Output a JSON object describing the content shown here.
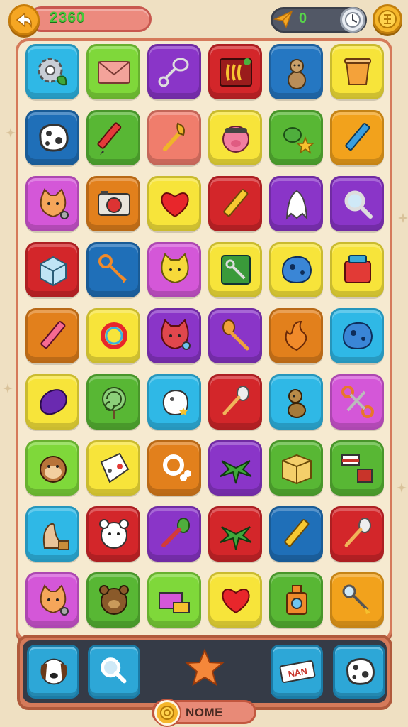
{
  "header": {
    "score": "2360",
    "plane_count": "0",
    "back_icon": "back-arrow-icon",
    "timer_icon": "clock-icon",
    "coin_icon": "coin-icon"
  },
  "board": {
    "columns": 6,
    "rows": 9,
    "tiles": [
      {
        "color": "#2fb8e6",
        "icon": "gear-leaf"
      },
      {
        "color": "#7fd83a",
        "icon": "envelope"
      },
      {
        "color": "#8a35c8",
        "icon": "racket"
      },
      {
        "color": "#d3262a",
        "icon": "book"
      },
      {
        "color": "#2577c2",
        "icon": "otter"
      },
      {
        "color": "#f7e43a",
        "icon": "cup"
      },
      {
        "color": "#1f6fb8",
        "icon": "rock"
      },
      {
        "color": "#58b734",
        "icon": "pencil-red"
      },
      {
        "color": "#f07d6c",
        "icon": "wrench"
      },
      {
        "color": "#f7e43a",
        "icon": "pig-face"
      },
      {
        "color": "#58b734",
        "icon": "pepper-star"
      },
      {
        "color": "#f2a21c",
        "icon": "pencil-blue"
      },
      {
        "color": "#d457d8",
        "icon": "cat-face"
      },
      {
        "color": "#e2801c",
        "icon": "camera"
      },
      {
        "color": "#f7e43a",
        "icon": "heart"
      },
      {
        "color": "#d3262a",
        "icon": "pencil-yellow"
      },
      {
        "color": "#8a35c8",
        "icon": "ghost"
      },
      {
        "color": "#8a35c8",
        "icon": "magnifier"
      },
      {
        "color": "#d3262a",
        "icon": "ice-cube"
      },
      {
        "color": "#1f6fb8",
        "icon": "key"
      },
      {
        "color": "#d457d8",
        "icon": "cat-face-yellow"
      },
      {
        "color": "#f7e43a",
        "icon": "wrench-box"
      },
      {
        "color": "#f7e43a",
        "icon": "blue-rock"
      },
      {
        "color": "#f7e43a",
        "icon": "bag"
      },
      {
        "color": "#e2801c",
        "icon": "pencil-pink"
      },
      {
        "color": "#f7e43a",
        "icon": "ring"
      },
      {
        "color": "#8a35c8",
        "icon": "cat-face-red"
      },
      {
        "color": "#8a35c8",
        "icon": "spoon"
      },
      {
        "color": "#e2801c",
        "icon": "flame"
      },
      {
        "color": "#2fb8e6",
        "icon": "blue-rock"
      },
      {
        "color": "#f7e43a",
        "icon": "eggplant"
      },
      {
        "color": "#58b734",
        "icon": "lollipop"
      },
      {
        "color": "#2fb8e6",
        "icon": "egg"
      },
      {
        "color": "#d3262a",
        "icon": "honey-dipper"
      },
      {
        "color": "#2fb8e6",
        "icon": "dog"
      },
      {
        "color": "#d457d8",
        "icon": "scissors"
      },
      {
        "color": "#7fd83a",
        "icon": "monkey-face"
      },
      {
        "color": "#f7e43a",
        "icon": "cheese"
      },
      {
        "color": "#e2801c",
        "icon": "bone-ring"
      },
      {
        "color": "#8a35c8",
        "icon": "plant"
      },
      {
        "color": "#58b734",
        "icon": "box"
      },
      {
        "color": "#58b734",
        "icon": "cake-bricks"
      },
      {
        "color": "#2fb8e6",
        "icon": "seal"
      },
      {
        "color": "#d3262a",
        "icon": "bear-face-white"
      },
      {
        "color": "#8a35c8",
        "icon": "brush"
      },
      {
        "color": "#d3262a",
        "icon": "plant"
      },
      {
        "color": "#1f6fb8",
        "icon": "pencil-yellow"
      },
      {
        "color": "#d3262a",
        "icon": "honey-dipper"
      },
      {
        "color": "#d457d8",
        "icon": "cat-face"
      },
      {
        "color": "#58b734",
        "icon": "bear-face"
      },
      {
        "color": "#7fd83a",
        "icon": "gift-box"
      },
      {
        "color": "#f7e43a",
        "icon": "heart"
      },
      {
        "color": "#58b734",
        "icon": "bottle"
      },
      {
        "color": "#f2a21c",
        "icon": "key-blue"
      }
    ]
  },
  "tray": {
    "slots": [
      {
        "icon": "dog-face"
      },
      {
        "icon": "magnifier-bone"
      },
      {
        "icon": "star"
      },
      {
        "icon": "name-tag",
        "text": "NAN"
      },
      {
        "icon": "rock"
      }
    ]
  },
  "footer": {
    "label": "NOME",
    "coin_icon": "coin-icon"
  }
}
